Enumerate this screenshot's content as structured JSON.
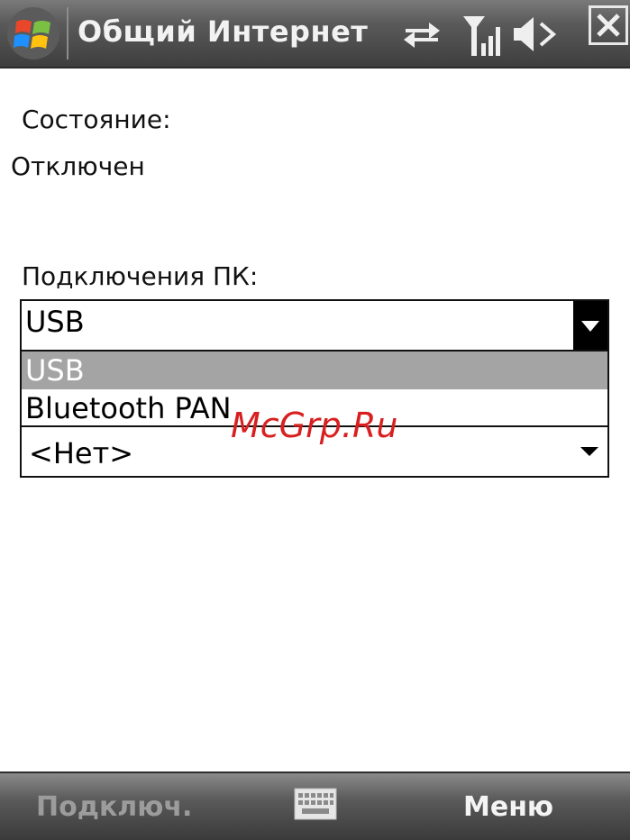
{
  "window": {
    "title": "Общий Интернет",
    "start_icon": "windows-flag-icon",
    "status_icons": [
      "sync-arrows-icon",
      "signal-strength-icon",
      "speaker-icon",
      "close-icon"
    ]
  },
  "status": {
    "label": "Состояние:",
    "value": "Отключен"
  },
  "pc_connection": {
    "label": "Подключения ПК:",
    "selected": "USB",
    "options": [
      "USB",
      "Bluetooth PAN"
    ],
    "highlighted_option": "USB"
  },
  "network": {
    "selected": "<Нет>"
  },
  "watermark": "McGrp.Ru",
  "softkeys": {
    "left": "Подключ.",
    "right": "Меню",
    "center_icon": "keyboard-icon"
  },
  "colors": {
    "selection": "#a4a4a4",
    "watermark": "#d82020"
  }
}
